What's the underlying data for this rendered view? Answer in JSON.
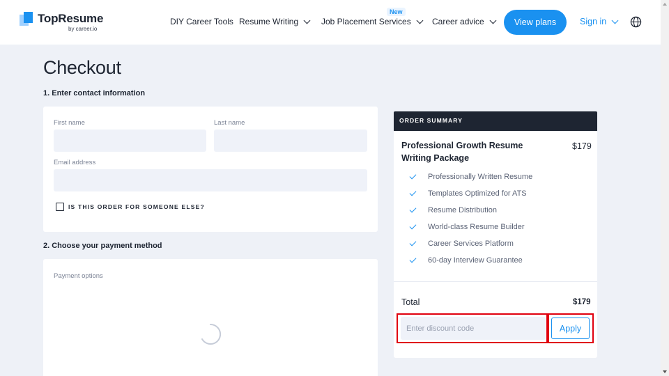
{
  "header": {
    "logo": {
      "name": "TopResume",
      "sub": "by career.io"
    },
    "nav": [
      {
        "label": "DIY Career Tools",
        "dropdown": false
      },
      {
        "label": "Resume Writing",
        "dropdown": true
      },
      {
        "label": "Job Placement Services",
        "dropdown": true,
        "badge": "New"
      },
      {
        "label": "Career advice",
        "dropdown": true
      }
    ],
    "view_plans": "View plans",
    "sign_in": "Sign in"
  },
  "page": {
    "title": "Checkout",
    "step1": "1. Enter contact information",
    "step2": "2. Choose your payment method"
  },
  "contact_form": {
    "first_name_label": "First name",
    "first_name_value": "",
    "last_name_label": "Last name",
    "last_name_value": "",
    "email_label": "Email address",
    "email_value": "",
    "someone_else_label": "IS THIS ORDER FOR SOMEONE ELSE?",
    "someone_else_checked": false
  },
  "payment": {
    "label": "Payment options"
  },
  "order_summary": {
    "heading": "ORDER SUMMARY",
    "package_name": "Professional Growth Resume Writing Package",
    "package_price": "$179",
    "features": [
      "Professionally Written Resume",
      "Templates Optimized for ATS",
      "Resume Distribution",
      "World-class Resume Builder",
      "Career Services Platform",
      "60-day Interview Guarantee"
    ],
    "total_label": "Total",
    "total_value": "$179",
    "discount_placeholder": "Enter discount code",
    "discount_value": "",
    "apply_label": "Apply"
  },
  "colors": {
    "accent": "#1a91f0",
    "dark": "#1e2532",
    "page_bg": "#eef1f7",
    "input_bg": "#eff2f9",
    "highlight": "#e0000f"
  },
  "icons": [
    "logo-mark-icon",
    "chevron-down-icon",
    "globe-icon",
    "check-icon",
    "loading-spinner-icon"
  ]
}
